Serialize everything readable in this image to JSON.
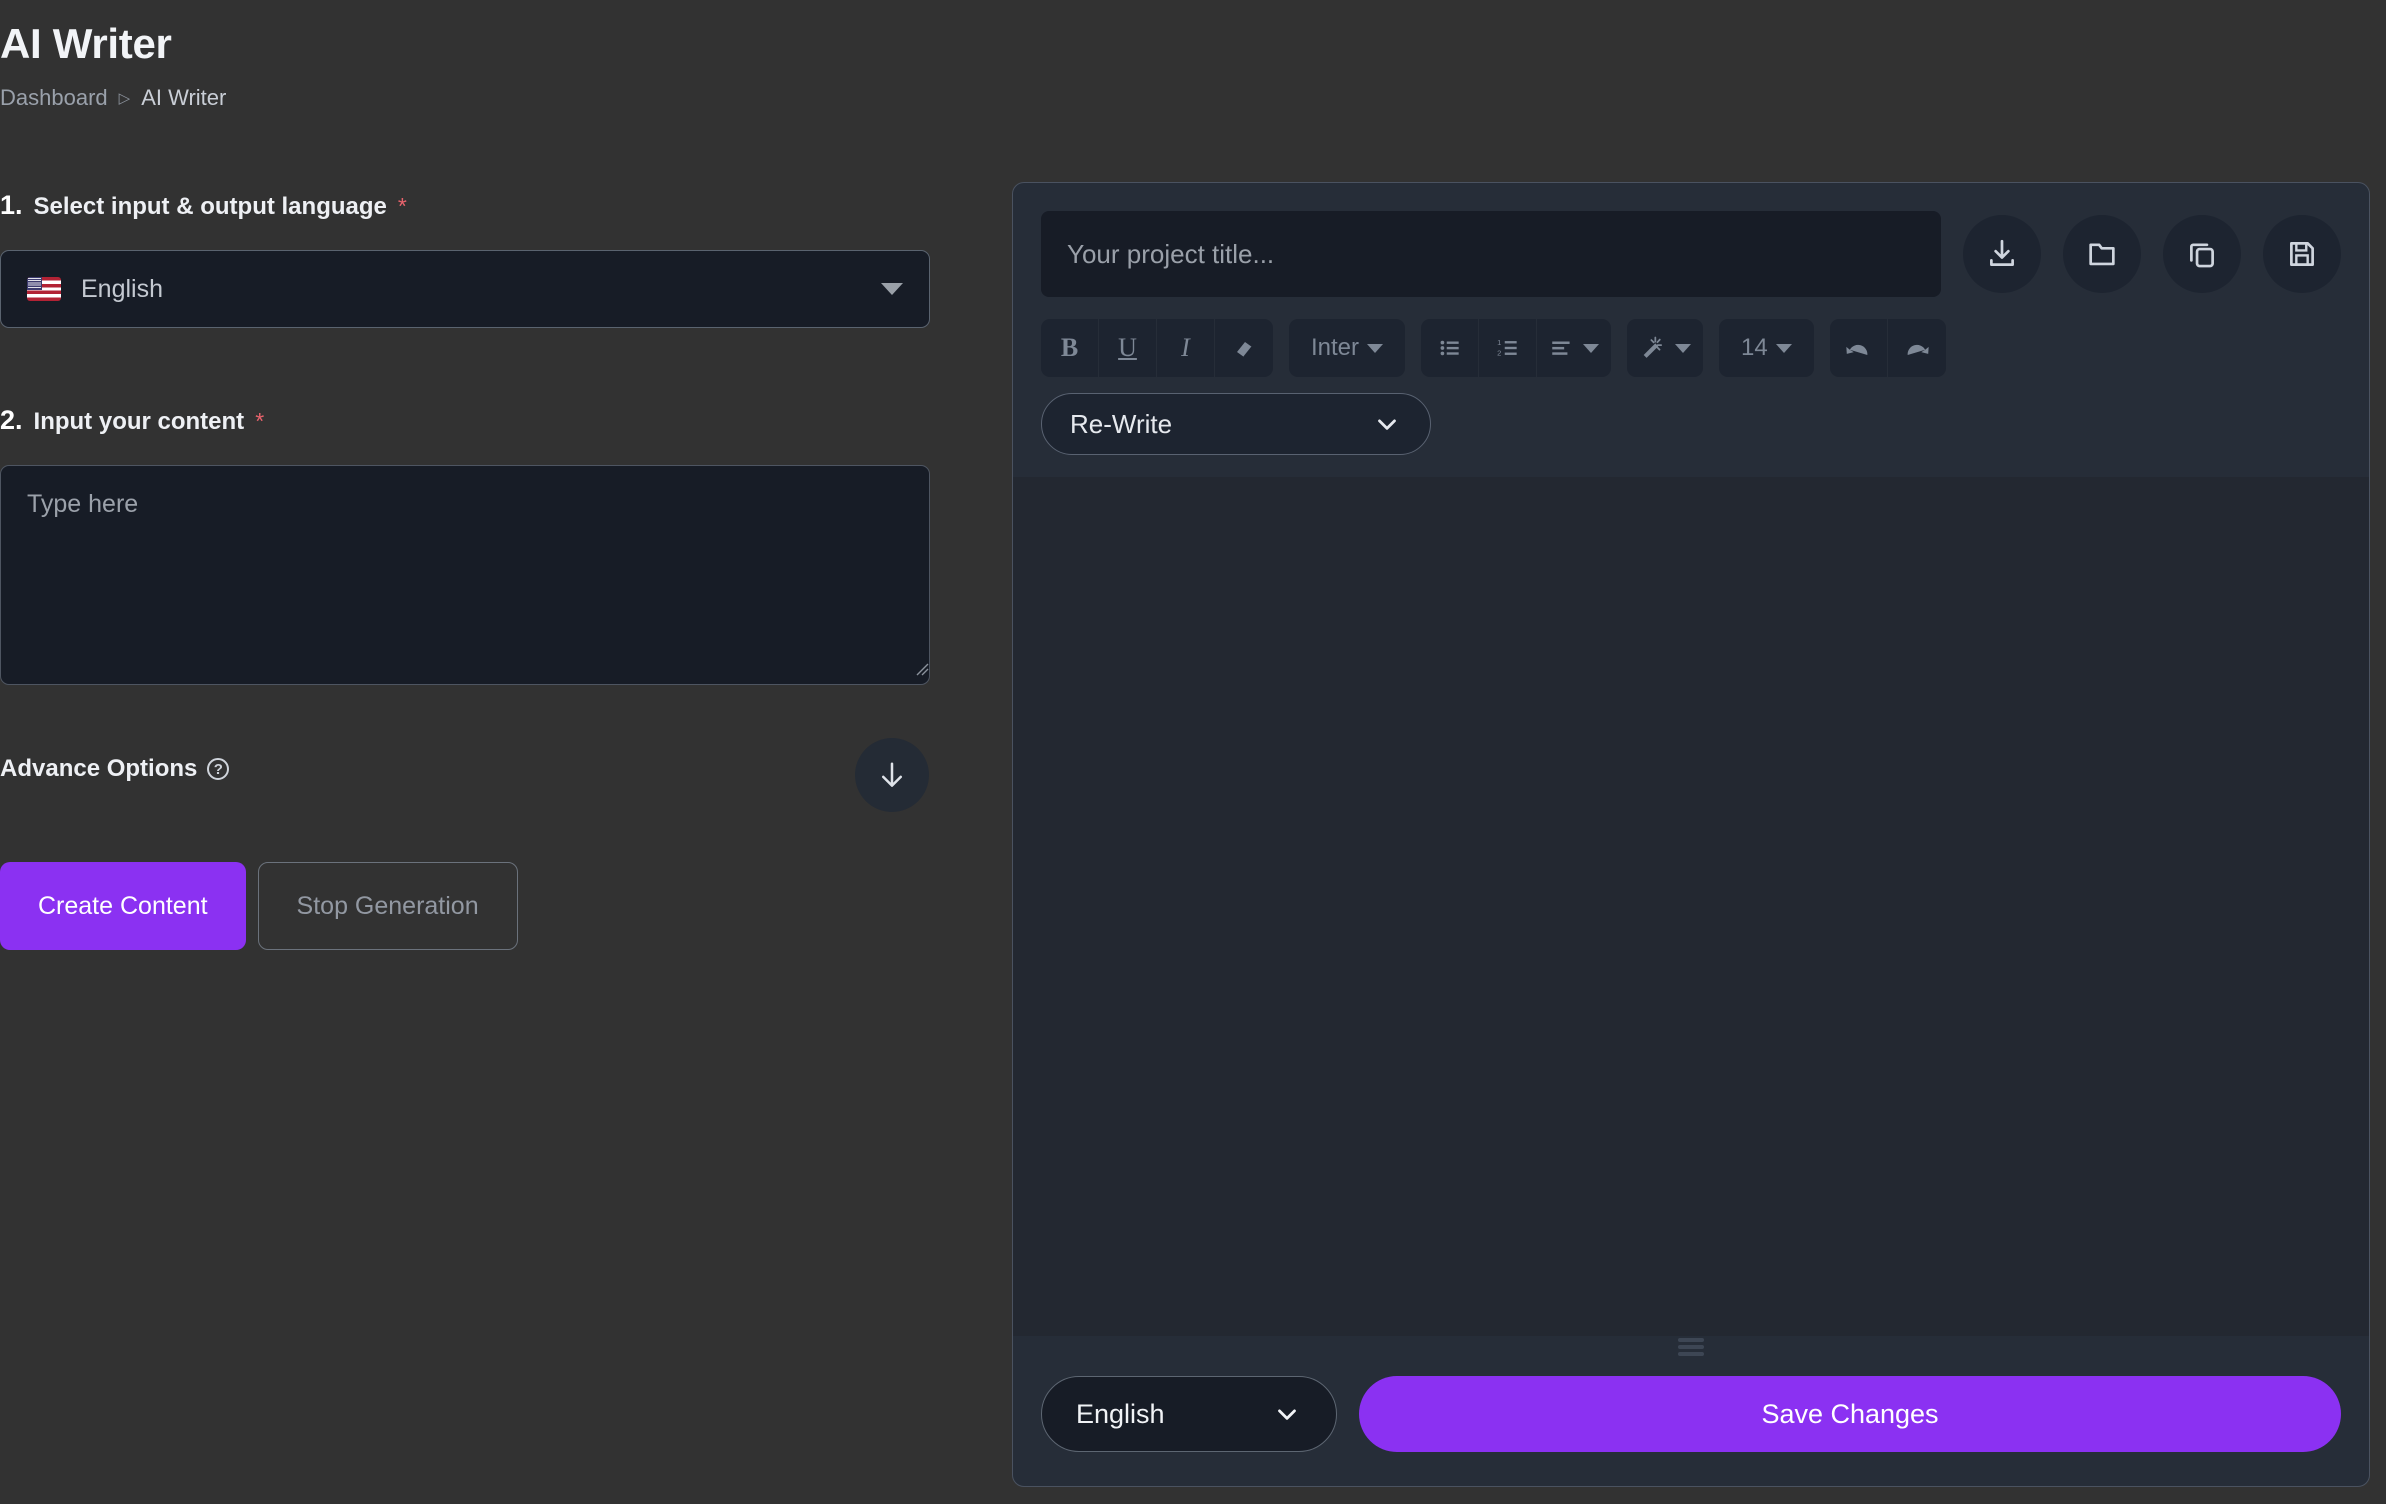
{
  "header": {
    "title": "AI Writer",
    "breadcrumb": {
      "parent": "Dashboard",
      "separator": "▷",
      "current": "AI Writer"
    }
  },
  "left": {
    "step1": {
      "number": "1.",
      "label": "Select input & output language",
      "required": "*"
    },
    "language_select": {
      "value": "English",
      "flag": "us-flag-icon",
      "caret": "caret-down-icon"
    },
    "step2": {
      "number": "2.",
      "label": "Input your content",
      "required": "*"
    },
    "content_textarea": {
      "placeholder": "Type here",
      "value": ""
    },
    "advance_options": {
      "label": "Advance Options",
      "help": "?"
    },
    "scroll_down": {
      "icon": "arrow-down-icon"
    },
    "buttons": {
      "create": "Create Content",
      "stop": "Stop Generation"
    }
  },
  "editor": {
    "title_input": {
      "placeholder": "Your project title...",
      "value": ""
    },
    "head_actions": [
      {
        "name": "download-icon",
        "label": "Download"
      },
      {
        "name": "folder-icon",
        "label": "Open folder"
      },
      {
        "name": "copy-icon",
        "label": "Copy"
      },
      {
        "name": "save-disk-icon",
        "label": "Save"
      }
    ],
    "toolbar": {
      "bold": "B",
      "underline": "U",
      "italic": "I",
      "eraser": "eraser-icon",
      "font_family": "Inter",
      "bullet_list": "bullet-list-icon",
      "numbered_list": "numbered-list-icon",
      "align": "align-left-icon",
      "text_color": "magic-wand-icon",
      "font_size": "14",
      "undo": "undo-icon",
      "redo": "redo-icon"
    },
    "rewrite_select": {
      "value": "Re-Write",
      "caret": "chevron-down-icon"
    },
    "body": {
      "content": ""
    },
    "footer": {
      "language": {
        "value": "English",
        "caret": "chevron-down-icon"
      },
      "save": "Save Changes"
    }
  },
  "colors": {
    "background": "#323232",
    "panel": "#262d38",
    "input": "#171c26",
    "editor_body": "#232831",
    "accent": "#8b31f2",
    "required": "#e8636c",
    "text": "#eef0f4",
    "muted": "#9aa1ab"
  }
}
